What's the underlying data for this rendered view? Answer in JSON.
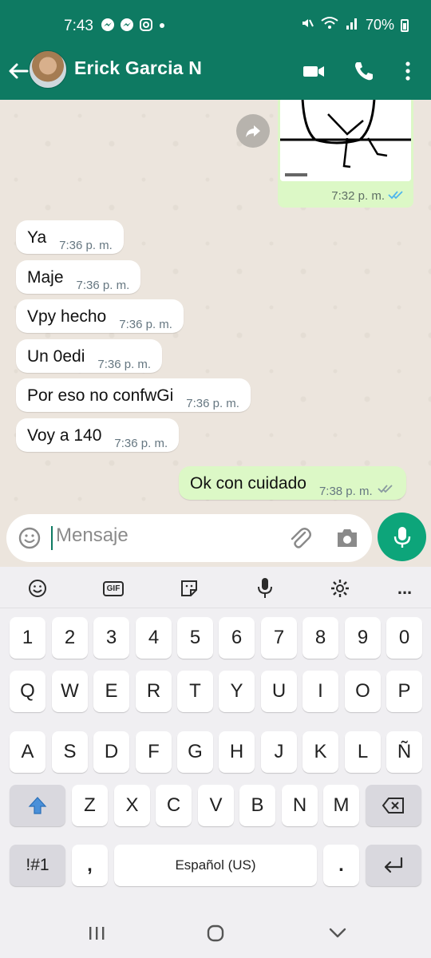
{
  "status_bar": {
    "time": "7:43",
    "battery": "70%",
    "icons": [
      "messenger-icon",
      "messenger-icon",
      "instagram-icon",
      "dot-icon",
      "mute-icon",
      "wifi-icon",
      "signal-icon",
      "battery-icon"
    ]
  },
  "header": {
    "contact_name": "Erick Garcia N"
  },
  "messages": [
    {
      "type": "image",
      "direction": "out",
      "time": "7:32 p. m.",
      "status": "read"
    },
    {
      "type": "text",
      "direction": "in",
      "text": "Ya",
      "time": "7:36 p. m."
    },
    {
      "type": "text",
      "direction": "in",
      "text": "Maje",
      "time": "7:36 p. m."
    },
    {
      "type": "text",
      "direction": "in",
      "text": "Vpy hecho",
      "time": "7:36 p. m."
    },
    {
      "type": "text",
      "direction": "in",
      "text": "Un 0edi",
      "time": "7:36 p. m."
    },
    {
      "type": "text",
      "direction": "in",
      "text": "Por eso no confwGi",
      "time": "7:36 p. m."
    },
    {
      "type": "text",
      "direction": "in",
      "text": "Voy a 140",
      "time": "7:36 p. m."
    },
    {
      "type": "text",
      "direction": "out",
      "text": "Ok con cuidado",
      "time": "7:38 p. m.",
      "status": "delivered"
    }
  ],
  "input": {
    "placeholder": "Mensaje"
  },
  "keyboard": {
    "toolbar": {
      "gif": "GIF",
      "more": "..."
    },
    "row_numbers": [
      "1",
      "2",
      "3",
      "4",
      "5",
      "6",
      "7",
      "8",
      "9",
      "0"
    ],
    "row_1": [
      "Q",
      "W",
      "E",
      "R",
      "T",
      "Y",
      "U",
      "I",
      "O",
      "P"
    ],
    "row_2": [
      "A",
      "S",
      "D",
      "F",
      "G",
      "H",
      "J",
      "K",
      "L",
      "Ñ"
    ],
    "row_3": [
      "Z",
      "X",
      "C",
      "V",
      "B",
      "N",
      "M"
    ],
    "symbols_key": "!#1",
    "comma_key": ",",
    "space_key": "Español (US)",
    "period_key": "."
  },
  "colors": {
    "header": "#0e7a62",
    "outgoing_bubble": "#dcf8c6",
    "incoming_bubble": "#ffffff",
    "mic_button": "#0da57a",
    "read_tick": "#4fb6ec",
    "delivered_tick": "#8a9aa0"
  }
}
